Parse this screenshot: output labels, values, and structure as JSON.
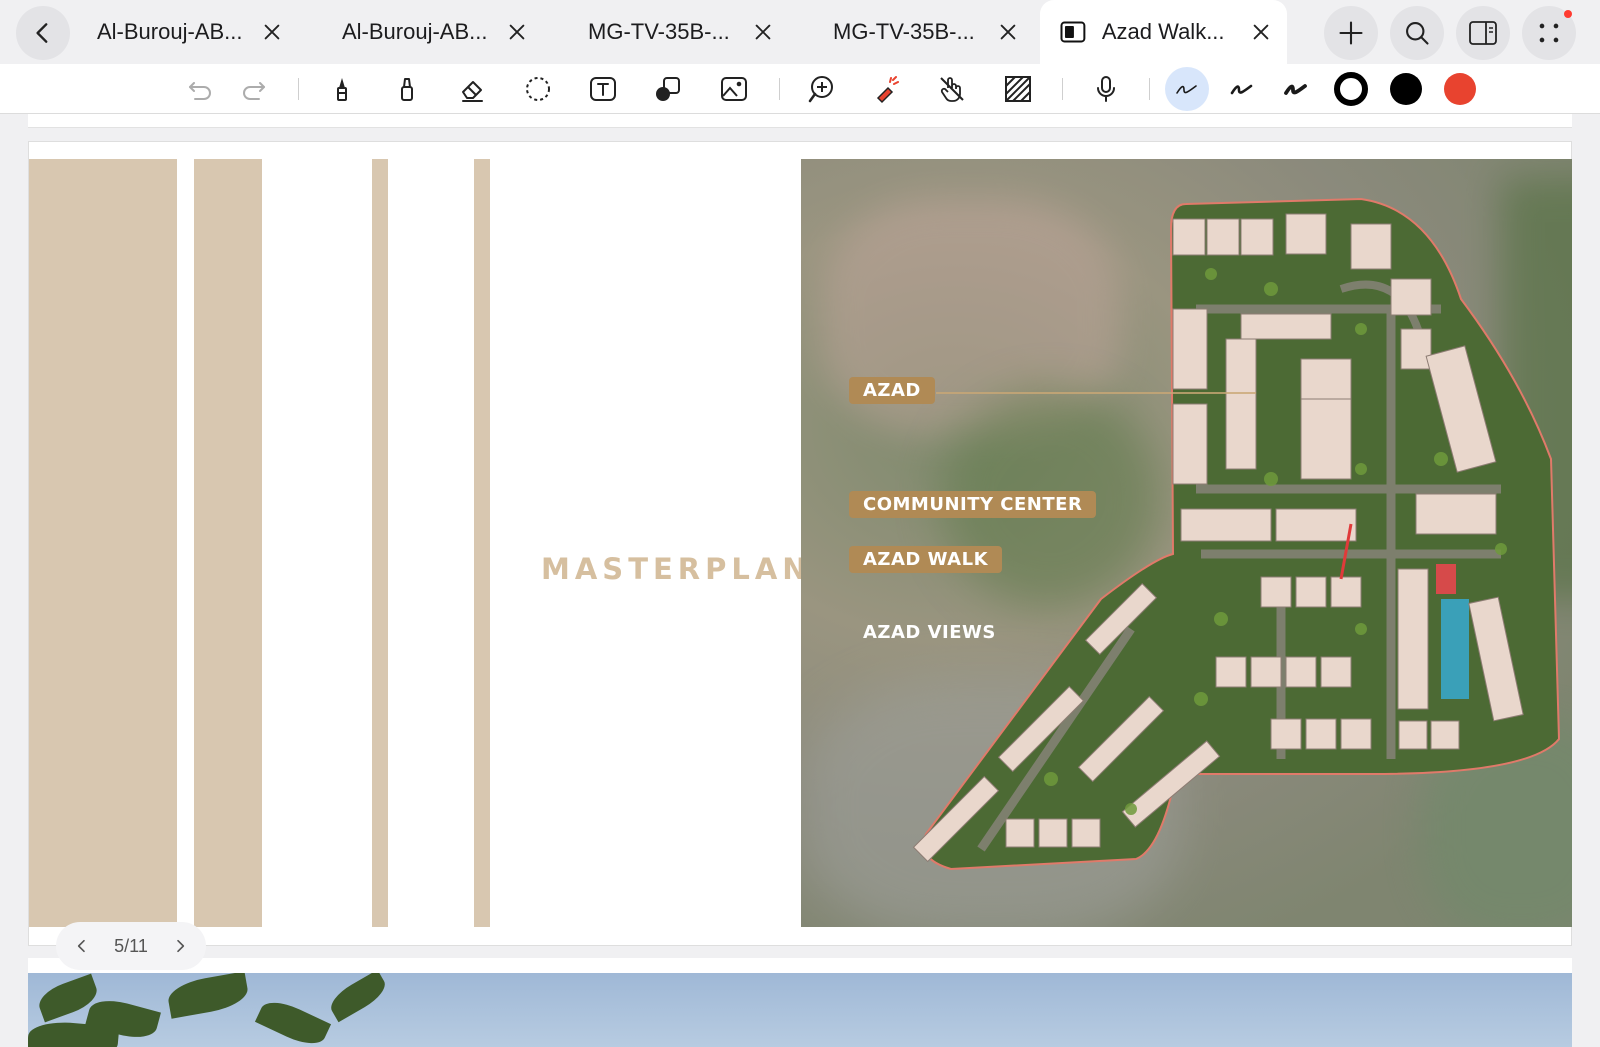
{
  "tabs": [
    {
      "label": "Al-Burouj-AB...",
      "active": false
    },
    {
      "label": "Al-Burouj-AB...",
      "active": false
    },
    {
      "label": "MG-TV-35B-...",
      "active": false
    },
    {
      "label": "MG-TV-35B-...",
      "active": false
    },
    {
      "label": "Azad Walk...",
      "active": true
    }
  ],
  "toolbar": {
    "tools": [
      "undo-icon",
      "redo-icon",
      "pen-icon",
      "highlighter-icon",
      "eraser-icon",
      "lasso-icon",
      "text-box-icon",
      "shapes-icon",
      "image-icon",
      "zoom-in-icon",
      "laser-pointer-icon",
      "touch-draw-icon",
      "hatch-icon",
      "microphone-icon",
      "stroke-thin-icon",
      "stroke-medium-icon",
      "stroke-thick-icon"
    ],
    "colors": [
      "#ffffff",
      "#000000",
      "#e8432f"
    ],
    "selected_color": "#000000",
    "selected_stroke": "thin"
  },
  "page": {
    "title": "MASTERPLAN",
    "labels": {
      "azad": "AZAD",
      "community_center": "COMMUNITY CENTER",
      "azad_walk": "AZAD WALK",
      "azad_views": "AZAD VIEWS"
    },
    "stripe_color": "#d8c7b0"
  },
  "pager": {
    "indicator": "5/11"
  }
}
